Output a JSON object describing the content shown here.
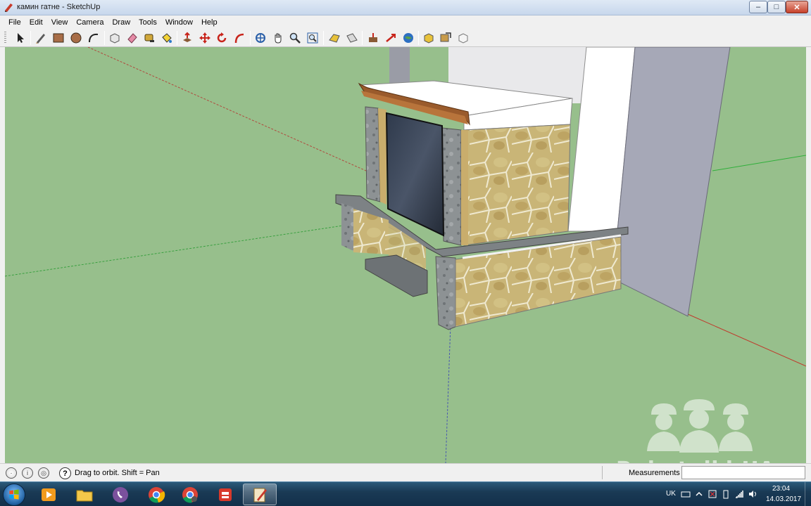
{
  "window": {
    "title": "камин гатне - SketchUp",
    "controls": {
      "minimize": "–",
      "maximize": "□",
      "close": "✕"
    }
  },
  "menu": [
    "File",
    "Edit",
    "View",
    "Camera",
    "Draw",
    "Tools",
    "Window",
    "Help"
  ],
  "toolbar": {
    "tools": [
      "select",
      "pencil",
      "rectangle",
      "circle",
      "arc",
      "make-component",
      "eraser",
      "tape-measure",
      "paint-bucket",
      "push-pull",
      "move",
      "rotate",
      "follow-me",
      "orbit",
      "pan",
      "zoom",
      "zoom-extents",
      "previous-view",
      "next-view",
      "google-earth-add-location",
      "get-models",
      "share-model",
      "get-photo-texture",
      "warehouse",
      "extension"
    ]
  },
  "viewport": {
    "background": "#97bf8c",
    "model": "fireplace with stone cladding"
  },
  "statusbar": {
    "hint": "Drag to orbit.  Shift = Pan",
    "help": "?",
    "measurements_label": "Measurements",
    "measurements_value": ""
  },
  "watermark": {
    "text": "Robotniki.UA"
  },
  "taskbar": {
    "apps": [
      "media-player",
      "file-explorer",
      "viber",
      "chrome",
      "chrome-alt",
      "sketchup",
      "sketchup-layout"
    ],
    "active_app": "sketchup-layout",
    "language": "UK",
    "time": "23:04",
    "date": "14.03.2017"
  }
}
